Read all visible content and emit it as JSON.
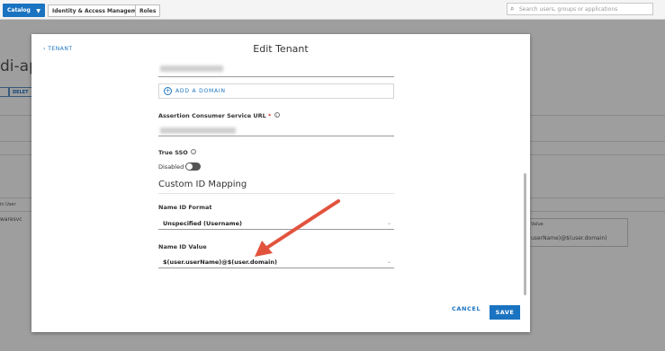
{
  "topbar": {
    "catalog_label": "Catalog",
    "tabs": [
      "Identity & Access Management",
      "Roles"
    ],
    "search_placeholder": "Search users, groups or applications"
  },
  "background": {
    "title": "di-app",
    "delete_label": "DELET",
    "col_left_header": "in User",
    "col_left_value": "waresvc",
    "col_right_header": "Value",
    "col_right_value": "userName)@$(user.domain)"
  },
  "modal": {
    "back_link": "‹ TENANT",
    "title": "Edit Tenant",
    "add_domain_label": "ADD A DOMAIN",
    "acs_label": "Assertion Consumer Service URL",
    "acs_required": "*",
    "true_sso_label": "True SSO",
    "true_sso_state": "Disabled",
    "true_sso_enabled": false,
    "custom_id_title": "Custom ID Mapping",
    "name_id_format_label": "Name ID Format",
    "name_id_format_value": "Unspecified (Username)",
    "name_id_value_label": "Name ID Value",
    "name_id_value_value": "$(user.userName)@$(user.domain)",
    "cancel_label": "CANCEL",
    "save_label": "SAVE"
  },
  "colors": {
    "accent": "#1a73c0",
    "annotation_arrow": "#e2533d"
  }
}
